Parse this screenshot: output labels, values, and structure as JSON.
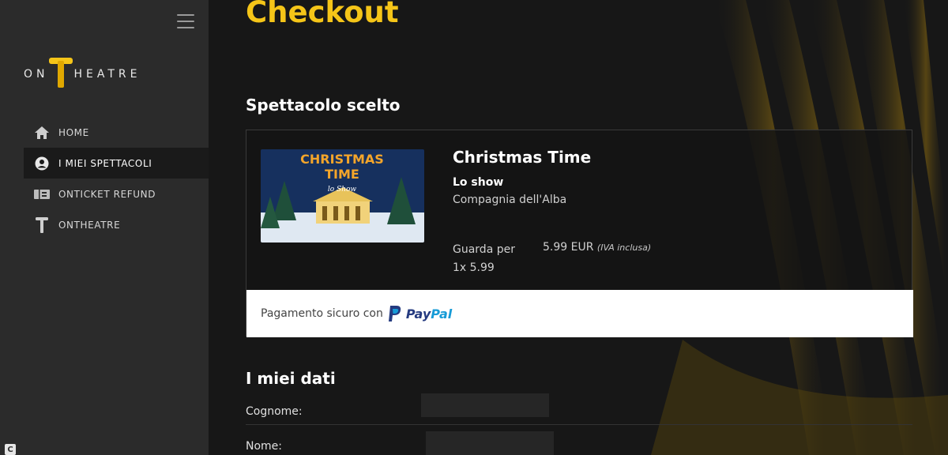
{
  "sidebar": {
    "logo": {
      "left": "ON",
      "right": "HEATRE"
    },
    "items": [
      {
        "label": "HOME",
        "icon": "home-icon"
      },
      {
        "label": "I MIEI SPETTACOLI",
        "icon": "user-circle-icon"
      },
      {
        "label": "ONTICKET REFUND",
        "icon": "ticket-icon"
      },
      {
        "label": "ONTHEATRE",
        "icon": "theatre-t-icon"
      }
    ]
  },
  "page": {
    "title": "Checkout",
    "show_section_title": "Spettacolo scelto",
    "data_section_title": "I miei dati"
  },
  "show": {
    "poster_title_line1": "CHRISTMAS",
    "poster_title_line2": "TIME",
    "poster_subtitle": "lo Show",
    "title": "Christmas Time",
    "subtitle": "Lo show",
    "company": "Compagnia dell'Alba",
    "watch_label": "Guarda per",
    "quantity": "1x 5.99",
    "price": "5.99 EUR",
    "price_note": "(IVA inclusa)"
  },
  "payment": {
    "secure_text": "Pagamento sicuro con",
    "brand_pay": "Pay",
    "brand_pal": "Pal"
  },
  "form": {
    "surname_label": "Cognome:",
    "name_label": "Nome:"
  },
  "colors": {
    "accent": "#f5c518",
    "sidebar_bg": "#2b2b2b",
    "main_bg": "#171717",
    "paypal_dark": "#253b80",
    "paypal_light": "#179bd7"
  }
}
